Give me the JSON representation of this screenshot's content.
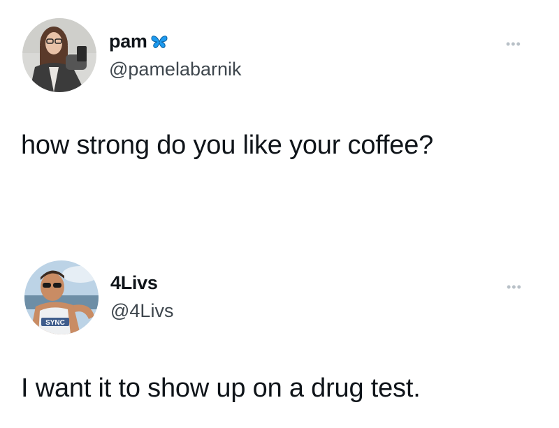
{
  "tweets": [
    {
      "display_name": "pam",
      "name_emoji_icon": "butterfly-icon",
      "handle": "@pamelabarnik",
      "text": "how strong do you like your coffee?",
      "more_icon": "more-options-icon"
    },
    {
      "display_name": "4Livs",
      "handle": "@4Livs",
      "text": "I want it to show up on a drug test.",
      "more_icon": "more-options-icon",
      "avatar_shirt_text": "SYNC"
    }
  ],
  "more_glyph": "•••",
  "colors": {
    "text": "#0f1419",
    "handle": "#3e464d",
    "butterfly": "#1d9bf0",
    "more": "#b8c0c7"
  }
}
